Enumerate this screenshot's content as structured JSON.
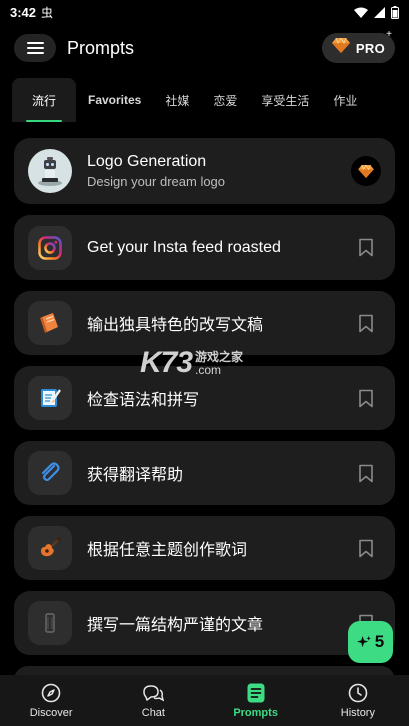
{
  "status_bar": {
    "time": "3:42",
    "notification_glyph": "虫"
  },
  "header": {
    "title": "Prompts",
    "pro_label": "PRO",
    "sparkle": "+"
  },
  "tabs": [
    {
      "label": "流行",
      "active": true
    },
    {
      "label": "Favorites"
    },
    {
      "label": "社媒"
    },
    {
      "label": "恋爱"
    },
    {
      "label": "享受生活"
    },
    {
      "label": "作业"
    }
  ],
  "prompts": [
    {
      "title": "Logo Generation",
      "subtitle": "Design your dream logo",
      "icon": "robot-logo-icon",
      "action": "pro-gem-icon"
    },
    {
      "title": "Get your Insta feed roasted",
      "icon": "instagram-icon",
      "action": "bookmark-icon"
    },
    {
      "title": "输出独具特色的改写文稿",
      "icon": "notebook-icon",
      "action": "bookmark-icon"
    },
    {
      "title": "检查语法和拼写",
      "icon": "checklist-icon",
      "action": "bookmark-icon"
    },
    {
      "title": "获得翻译帮助",
      "icon": "paperclip-icon",
      "action": "bookmark-icon"
    },
    {
      "title": "根据任意主题创作歌词",
      "icon": "guitar-icon",
      "action": "bookmark-icon"
    },
    {
      "title": "撰写一篇结构严谨的文章",
      "icon": "scroll-icon",
      "action": "bookmark-icon"
    }
  ],
  "watermark": {
    "main": "K73",
    "cn": "游戏之家",
    "domain": ".com"
  },
  "fab": {
    "count": "5"
  },
  "bottom_nav": [
    {
      "label": "Discover",
      "icon": "compass-icon"
    },
    {
      "label": "Chat",
      "icon": "chat-bubbles-icon"
    },
    {
      "label": "Prompts",
      "icon": "prompts-doc-icon",
      "active": true
    },
    {
      "label": "History",
      "icon": "clock-icon"
    }
  ],
  "colors": {
    "accent": "#3ddc84",
    "card": "#1e1e1e",
    "background": "#000000",
    "gem": "#f39a3b"
  }
}
